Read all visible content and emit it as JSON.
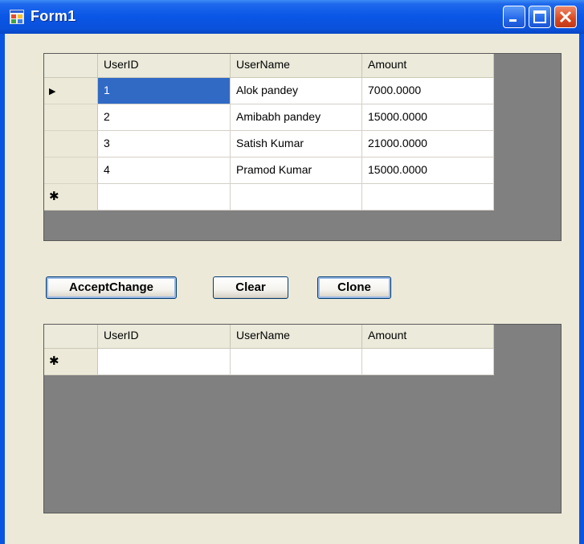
{
  "window": {
    "title": "Form1"
  },
  "grid1": {
    "columns": [
      "UserID",
      "UserName",
      "Amount"
    ],
    "rows": [
      {
        "id": "1",
        "name": "Alok pandey",
        "amount": "7000.0000"
      },
      {
        "id": "2",
        "name": "Amibabh pandey",
        "amount": "15000.0000"
      },
      {
        "id": "3",
        "name": "Satish Kumar",
        "amount": "21000.0000"
      },
      {
        "id": "4",
        "name": "Pramod Kumar",
        "amount": "15000.0000"
      }
    ],
    "current_row_glyph": "▶",
    "new_row_glyph": "✱"
  },
  "buttons": {
    "accept": "AcceptChange",
    "clear": "Clear",
    "clone": "Clone"
  },
  "grid2": {
    "columns": [
      "UserID",
      "UserName",
      "Amount"
    ],
    "new_row_glyph": "✱"
  },
  "colors": {
    "titlebar": "#0a54e3",
    "form_bg": "#ece9d8",
    "grid_bg": "#808080",
    "selection": "#316ac5"
  }
}
